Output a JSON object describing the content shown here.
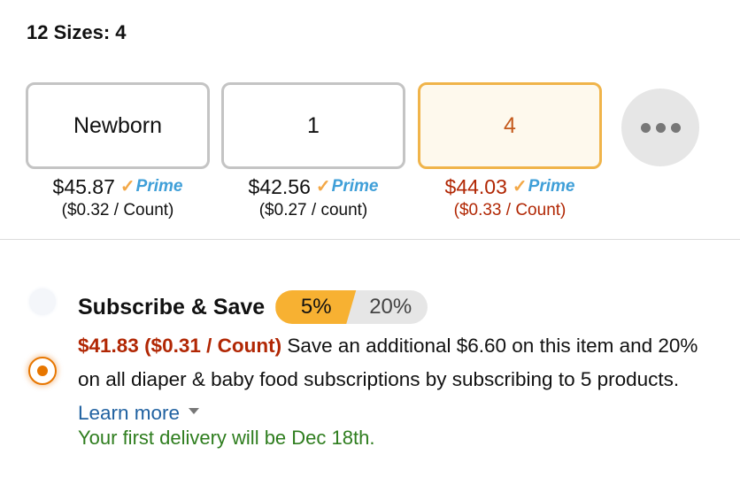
{
  "sizes_title": "12 Sizes: 4",
  "options": [
    {
      "label": "Newborn",
      "price": "$45.87",
      "prime": "Prime",
      "unit_price": "($0.32 / Count)"
    },
    {
      "label": "1",
      "price": "$42.56",
      "prime": "Prime",
      "unit_price": "($0.27 / count)"
    },
    {
      "label": "4",
      "price": "$44.03",
      "prime": "Prime",
      "unit_price": "($0.33 / Count)"
    }
  ],
  "selected_size": "4",
  "subscribe": {
    "title": "Subscribe & Save",
    "badge_low": "5%",
    "badge_high": "20%",
    "price_line": "$41.83 ($0.31 / Count)",
    "description": " Save an additional $6.60 on this item and 20% on all diaper & baby food subscriptions by subscribing to 5 products. ",
    "learn_more": "Learn more",
    "delivery": "Your first delivery will be Dec 18th."
  },
  "colors": {
    "accent_orange": "#e77600",
    "price_red": "#b12704",
    "link_blue": "#2162a1",
    "delivery_green": "#2e7d1e",
    "badge_orange": "#f7b132"
  },
  "icons": [
    "prime-check-icon",
    "more-options-icon",
    "chevron-down-icon"
  ]
}
